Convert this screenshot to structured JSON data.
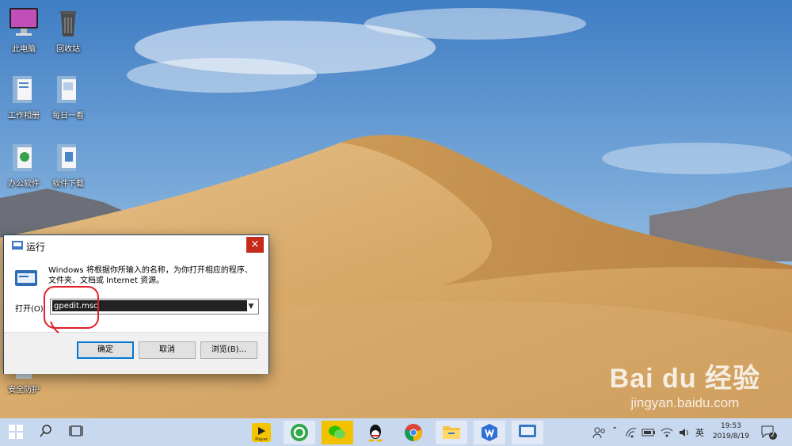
{
  "desktop": {
    "icons": [
      {
        "label": "此电脑"
      },
      {
        "label": "回收站"
      },
      {
        "label": "工作相册"
      },
      {
        "label": "每日一看"
      },
      {
        "label": "办公软件"
      },
      {
        "label": "软件下载"
      },
      {
        "label": "安全防护"
      }
    ]
  },
  "run_dialog": {
    "title": "运行",
    "close_glyph": "×",
    "description": "Windows 将根据你所输入的名称，为你打开相应的程序、文件夹、文档或 Internet 资源。",
    "open_label": "打开(O):",
    "input_value": "gpedit.msc",
    "buttons": {
      "ok": "确定",
      "cancel": "取消",
      "browse": "浏览(B)..."
    }
  },
  "taskbar": {
    "pinned": [
      {
        "icon": "player-icon",
        "label": "Player"
      },
      {
        "icon": "green-refresh-icon"
      },
      {
        "icon": "wechat-icon"
      },
      {
        "icon": "qq-icon"
      },
      {
        "icon": "chrome-icon"
      },
      {
        "icon": "file-explorer-icon"
      },
      {
        "icon": "wps-icon"
      },
      {
        "icon": "run-dialog-icon"
      }
    ],
    "ime": "英",
    "time": "19:53",
    "date": "2019/8/19",
    "notification_count": "2"
  },
  "watermark": {
    "brand": "Bai du 经验",
    "site": "jingyan.baidu.com"
  },
  "colors": {
    "dialog_border": "#1f3f66",
    "close_red": "#c42b1c",
    "annotation_red": "#e0212b",
    "taskbar": "#d2e0f2"
  }
}
